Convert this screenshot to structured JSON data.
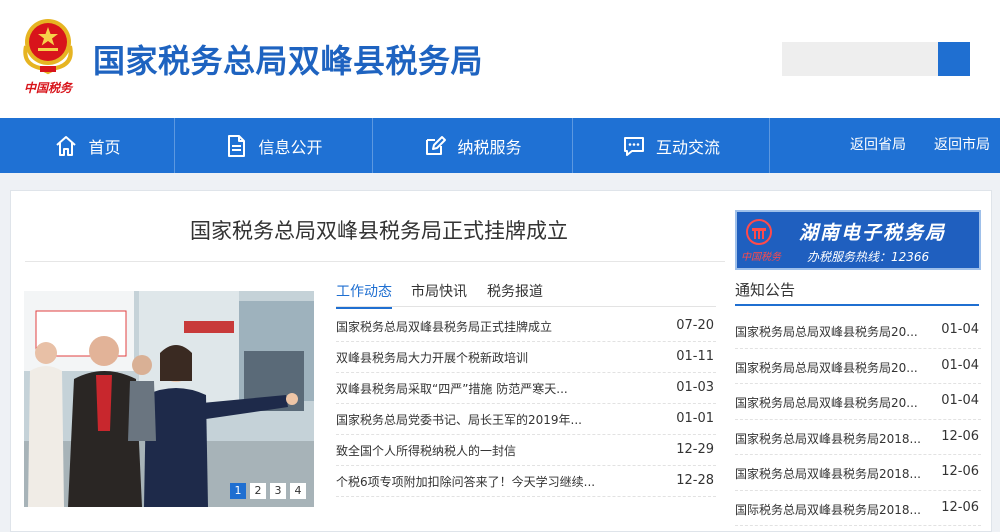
{
  "header": {
    "site_title": "国家税务总局双峰县税务局",
    "emblem_caption": "中国税务",
    "search": {
      "placeholder": "",
      "value": "",
      "button_icon": "search-icon"
    }
  },
  "nav": {
    "items": [
      {
        "label": "首页",
        "icon": "home-icon"
      },
      {
        "label": "信息公开",
        "icon": "document-icon"
      },
      {
        "label": "纳税服务",
        "icon": "edit-icon"
      },
      {
        "label": "互动交流",
        "icon": "chat-icon"
      }
    ],
    "links": [
      "返回省局",
      "返回市局"
    ]
  },
  "headline": "国家税务总局双峰县税务局正式挂牌成立",
  "carousel": {
    "pages": [
      "1",
      "2",
      "3",
      "4"
    ],
    "active": "1"
  },
  "news": {
    "tabs": [
      "工作动态",
      "市局快讯",
      "税务报道"
    ],
    "active_tab": "工作动态",
    "items": [
      {
        "title": "国家税务总局双峰县税务局正式挂牌成立",
        "date": "07-20"
      },
      {
        "title": "双峰县税务局大力开展个税新政培训",
        "date": "01-11"
      },
      {
        "title": "双峰县税务局采取“四严”措施 防范严寒天...",
        "date": "01-03"
      },
      {
        "title": "国家税务总局党委书记、局长王军的2019年...",
        "date": "01-01"
      },
      {
        "title": "致全国个人所得税纳税人的一封信",
        "date": "12-29"
      },
      {
        "title": "个税6项专项附加扣除问答来了！今天学习继续...",
        "date": "12-28"
      }
    ]
  },
  "banner": {
    "title": "湖南电子税务局",
    "brand": "中国税务",
    "hotline": "办税服务热线：12366"
  },
  "notices": {
    "title": "通知公告",
    "items": [
      {
        "title": "国家税务局总局双峰县税务局20...",
        "date": "01-04"
      },
      {
        "title": "国家税务局总局双峰县税务局20...",
        "date": "01-04"
      },
      {
        "title": "国家税务局总局双峰县税务局20...",
        "date": "01-04"
      },
      {
        "title": "国家税务总局双峰县税务局2018...",
        "date": "12-06"
      },
      {
        "title": "国家税务总局双峰县税务局2018...",
        "date": "12-06"
      },
      {
        "title": "国际税务总局双峰县税务局2018...",
        "date": "12-06"
      }
    ]
  },
  "colors": {
    "brand_blue": "#1f71d4",
    "title_blue": "#1e63c0",
    "emblem_red": "#d8141b",
    "emblem_gold": "#e6b422"
  }
}
